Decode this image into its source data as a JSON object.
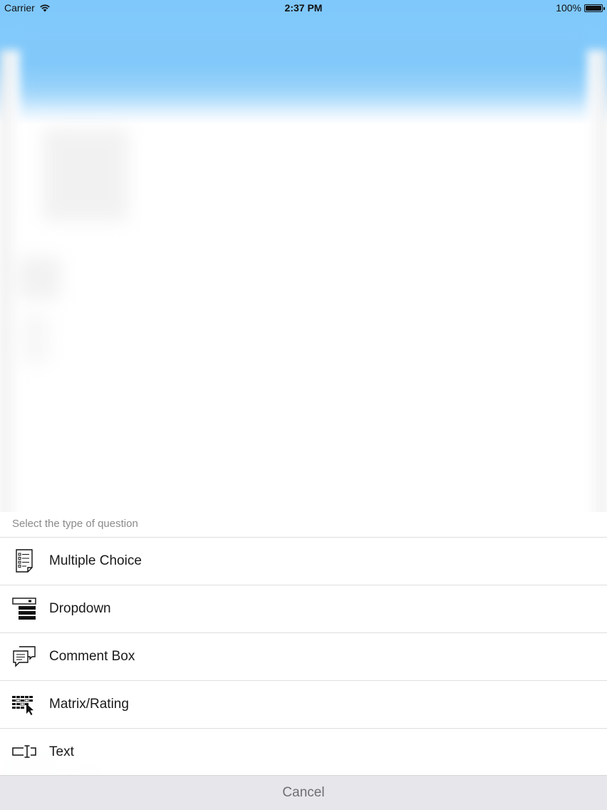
{
  "status_bar": {
    "carrier": "Carrier",
    "time": "2:37 PM",
    "battery": "100%"
  },
  "sheet": {
    "title": "Select the type of question",
    "options": [
      {
        "label": "Multiple Choice",
        "icon": "multiple-choice-icon"
      },
      {
        "label": "Dropdown",
        "icon": "dropdown-icon"
      },
      {
        "label": "Comment Box",
        "icon": "comment-box-icon"
      },
      {
        "label": "Matrix/Rating",
        "icon": "matrix-rating-icon"
      },
      {
        "label": "Text",
        "icon": "text-field-icon"
      }
    ],
    "cancel_label": "Cancel"
  },
  "colors": {
    "header_blue": "#7ec8fb",
    "separator": "#dedede",
    "cancel_background": "#e7e6ea",
    "title_gray": "#8a8a8a"
  }
}
